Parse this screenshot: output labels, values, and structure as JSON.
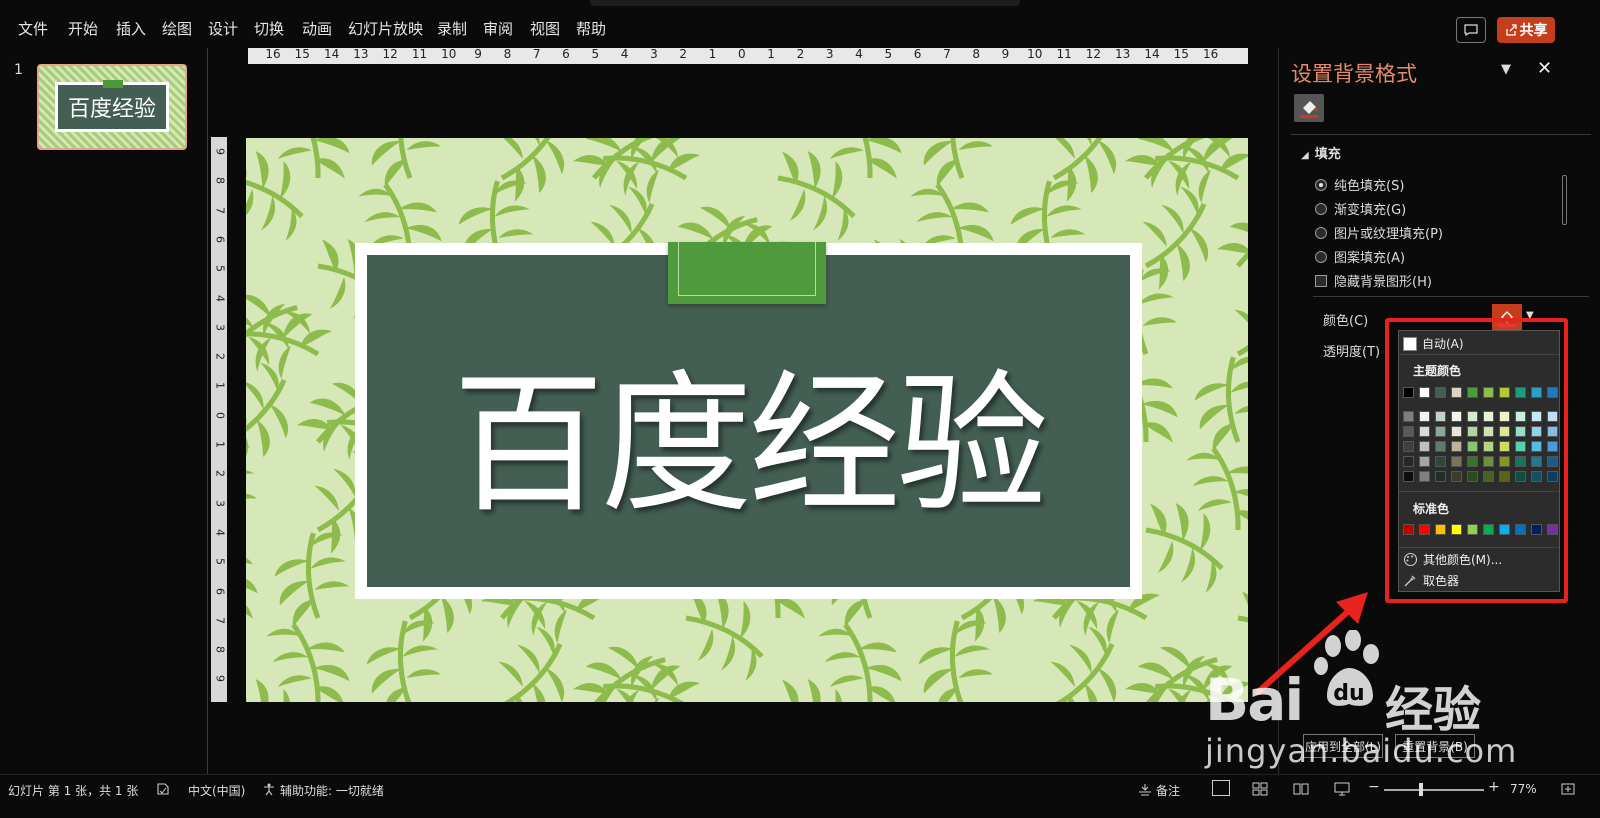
{
  "menu": {
    "items": [
      "文件",
      "开始",
      "插入",
      "绘图",
      "设计",
      "切换",
      "动画",
      "幻灯片放映",
      "录制",
      "审阅",
      "视图",
      "帮助"
    ],
    "share_label": "共享"
  },
  "thumbnails": {
    "number": "1",
    "title": "百度经验"
  },
  "ruler": {
    "horizontal": [
      "16",
      "15",
      "14",
      "13",
      "12",
      "11",
      "10",
      "9",
      "8",
      "7",
      "6",
      "5",
      "4",
      "3",
      "2",
      "1",
      "0",
      "1",
      "2",
      "3",
      "4",
      "5",
      "6",
      "7",
      "8",
      "9",
      "10",
      "11",
      "12",
      "13",
      "14",
      "15",
      "16"
    ],
    "vertical": [
      "9",
      "8",
      "7",
      "6",
      "5",
      "4",
      "3",
      "2",
      "1",
      "0",
      "1",
      "2",
      "3",
      "4",
      "5",
      "6",
      "7",
      "8",
      "9"
    ]
  },
  "slide": {
    "title": "百度经验",
    "colors": {
      "background": "#d7e8b8",
      "leaf": "#8dbb4c",
      "panel": "#435e52",
      "tab": "#4f9a3c"
    }
  },
  "panel": {
    "title": "设置背景格式",
    "fill_header": "填充",
    "options": [
      {
        "label": "纯色填充(S)",
        "selected": true
      },
      {
        "label": "渐变填充(G)",
        "selected": false
      },
      {
        "label": "图片或纹理填充(P)",
        "selected": false
      },
      {
        "label": "图案填充(A)",
        "selected": false
      }
    ],
    "hide_bg_graphics": "隐藏背景图形(H)",
    "color_label": "颜色(C)",
    "transparency_label": "透明度(T)",
    "apply_all": "应用到全部(L)",
    "reset": "重置背景(B)"
  },
  "color_popup": {
    "auto": "自动(A)",
    "theme_colors_label": "主题颜色",
    "standard_colors_label": "标准色",
    "more_colors": "其他颜色(M)...",
    "eyedropper": "取色器",
    "theme_top": [
      "#000000",
      "#ffffff",
      "#435e52",
      "#d9d4c4",
      "#4f9a3c",
      "#8dbb4c",
      "#b5c934",
      "#1f9a7a",
      "#2aa0c8",
      "#1f7abf"
    ],
    "theme_shades": [
      [
        "#7f7f7f",
        "#f2f2f2",
        "#c2d2cb",
        "#f4f2ec",
        "#d7ebcf",
        "#e6f1d6",
        "#eef3c9",
        "#c9efe3",
        "#c7e9f5",
        "#c2ddf3"
      ],
      [
        "#595959",
        "#d9d9d9",
        "#8aa89a",
        "#e8e4d9",
        "#b0d79f",
        "#cde3ad",
        "#dde894",
        "#93e0c7",
        "#8fd3eb",
        "#86bce7"
      ],
      [
        "#3f3f3f",
        "#bfbfbf",
        "#5d7c6e",
        "#bcb59d",
        "#88c370",
        "#b2d585",
        "#ccdc5e",
        "#5cd0ab",
        "#57bde1",
        "#4a9bdb"
      ],
      [
        "#262626",
        "#a6a6a6",
        "#324539",
        "#7c7456",
        "#3b732d",
        "#6a9339",
        "#879623",
        "#17735b",
        "#1f7896",
        "#175c8f"
      ],
      [
        "#0d0d0d",
        "#7f7f7f",
        "#212e26",
        "#3e3a2b",
        "#274d1e",
        "#466226",
        "#5a6417",
        "#0f4d3d",
        "#154f64",
        "#0f3d5f"
      ]
    ],
    "standard": [
      "#c00000",
      "#ff0000",
      "#ffc000",
      "#ffff00",
      "#92d050",
      "#00b050",
      "#00b0f0",
      "#0070c0",
      "#002060",
      "#7030a0"
    ]
  },
  "watermark": {
    "logo_text": "Bai",
    "logo_text2": "du",
    "cn_text": "经验",
    "url": "jingyan.baidu.com"
  },
  "status": {
    "slide_info": "幻灯片 第 1 张，共 1 张",
    "language": "中文(中国)",
    "accessibility": "辅助功能: 一切就绪",
    "notes": "备注",
    "zoom": "77%",
    "zoom_minus": "−",
    "zoom_plus": "+"
  }
}
